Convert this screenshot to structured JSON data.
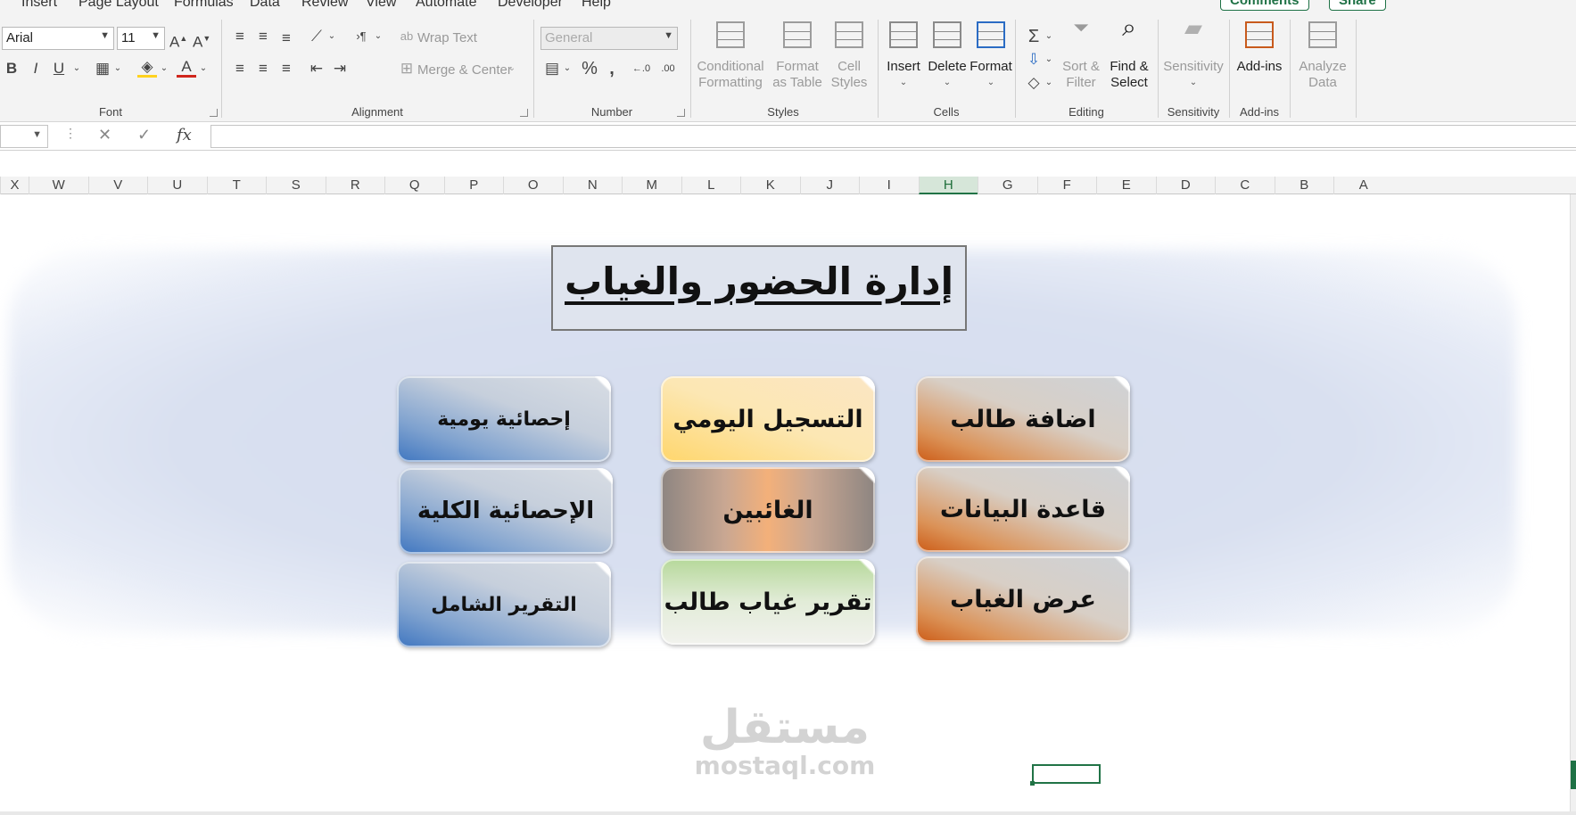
{
  "tabs": [
    {
      "label": "Insert"
    },
    {
      "label": "Page Layout"
    },
    {
      "label": "Formulas"
    },
    {
      "label": "Data"
    },
    {
      "label": "Review"
    },
    {
      "label": "View"
    },
    {
      "label": "Automate"
    },
    {
      "label": "Developer"
    },
    {
      "label": "Help"
    }
  ],
  "top_buttons": {
    "comments": "Comments",
    "share": "Share"
  },
  "ribbon": {
    "font": {
      "name": "Arial",
      "size": "11",
      "group_label": "Font"
    },
    "alignment": {
      "wrap_text": "Wrap Text",
      "merge_center": "Merge & Center",
      "group_label": "Alignment"
    },
    "number": {
      "format": "General",
      "group_label": "Number"
    },
    "styles": {
      "conditional": "Conditional Formatting",
      "format_table": "Format as Table",
      "cell_styles": "Cell Styles",
      "group_label": "Styles"
    },
    "cells": {
      "insert": "Insert",
      "delete": "Delete",
      "format": "Format",
      "group_label": "Cells"
    },
    "editing": {
      "sort_filter": "Sort & Filter",
      "find_select": "Find & Select",
      "group_label": "Editing"
    },
    "sensitivity": {
      "label": "Sensitivity",
      "group_label": "Sensitivity"
    },
    "addins": {
      "label": "Add-ins",
      "group_label": "Add-ins"
    },
    "analyze": {
      "label": "Analyze Data"
    }
  },
  "formula_bar": {
    "fx": "fx",
    "value": ""
  },
  "columns": [
    "W",
    "V",
    "U",
    "T",
    "S",
    "R",
    "Q",
    "P",
    "O",
    "N",
    "M",
    "L",
    "K",
    "J",
    "I",
    "H",
    "G",
    "F",
    "E",
    "D",
    "C",
    "B",
    "A"
  ],
  "selected_column": "H",
  "sheet": {
    "title": "إدارة الحضور والغياب",
    "buttons": {
      "add_student": "اضافة طالب",
      "database": "قاعدة البيانات",
      "view_absence": "عرض الغياب",
      "daily_register": "التسجيل اليومي",
      "absentees": "الغائبين",
      "student_absence_report": "تقرير غياب طالب",
      "daily_stats": "إحصائية يومية",
      "total_stats": "الإحصائية الكلية",
      "full_report": "التقرير الشامل"
    },
    "watermark": {
      "arabic": "مستقل",
      "latin": "mostaql.com"
    }
  },
  "colors": {
    "accent": "#217346",
    "title_bg": "#dfe4ee"
  }
}
